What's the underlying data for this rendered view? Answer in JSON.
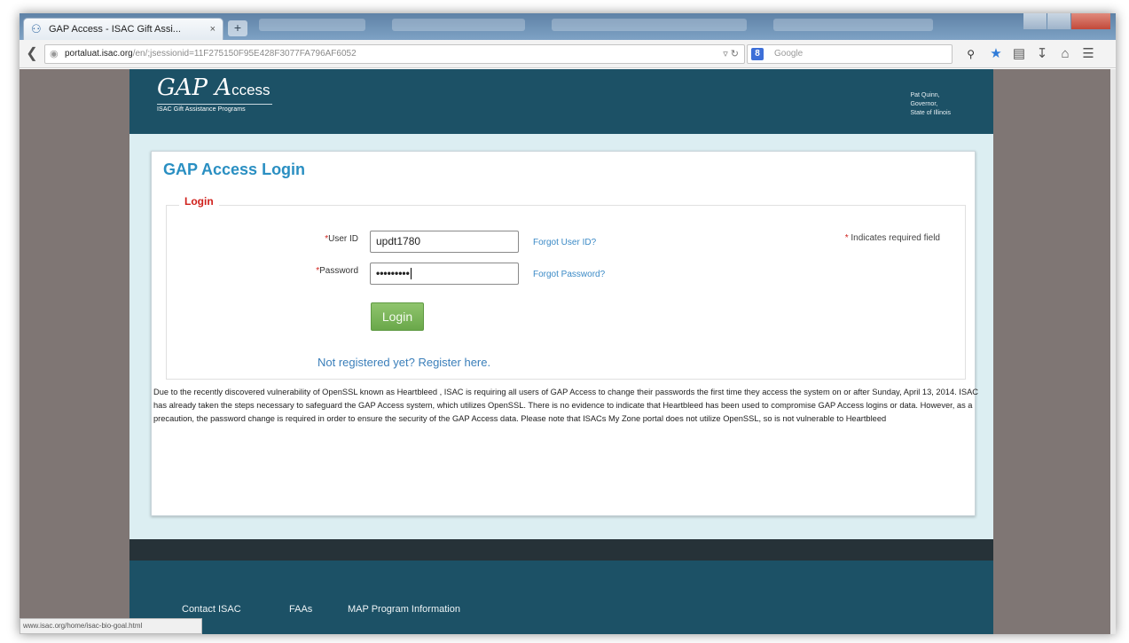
{
  "browser": {
    "tab_title": "GAP Access - ISAC Gift Assi...",
    "tab_close": "×",
    "new_tab": "+",
    "url_host": "portaluat.isac.org",
    "url_prefix": "",
    "url_path": "/en/;jsessionid=11F275150F95E428F3077FA796AF6052",
    "search_engine_badge": "8",
    "search_placeholder": "Google",
    "status_url": "www.isac.org/home/isac-bio-goal.html"
  },
  "header": {
    "logo_main": "GAP A",
    "logo_cess": "ccess",
    "logo_sub": "ISAC Gift Assistance Programs",
    "governor_line1": "Pat Quinn,",
    "governor_line2": "Governor,",
    "governor_line3": "State of Illinois"
  },
  "login": {
    "page_title": "GAP Access Login",
    "legend": "Login",
    "required_mark": "*",
    "userid_label": "User ID",
    "userid_value": "updt1780",
    "forgot_userid": "Forgot User ID?",
    "password_label": "Password",
    "password_value": "•••••••••",
    "forgot_password": "Forgot Password?",
    "required_note": "Indicates required field",
    "login_button": "Login",
    "register_link": "Not registered yet? Register here."
  },
  "notice": "Due to the recently discovered vulnerability of OpenSSL known as Heartbleed , ISAC is requiring all users of GAP Access to change their passwords the first time they access the system on or after Sunday, April 13, 2014. ISAC has already taken the steps necessary to safeguard the GAP Access system, which utilizes OpenSSL. There is no evidence to indicate that Heartbleed has been used to compromise GAP Access logins or data. However, as a precaution, the password change is required in order to ensure the security of the GAP Access data. Please note that ISACs My Zone portal does not utilize OpenSSL, so is not vulnerable to Heartbleed",
  "footer": {
    "links": [
      "Contact ISAC",
      "FAAs",
      "MAP Program Information"
    ]
  },
  "colors": {
    "header": "#1c5166",
    "title": "#2a8fc2",
    "required": "#d0211c",
    "button": "#7ab65a"
  }
}
